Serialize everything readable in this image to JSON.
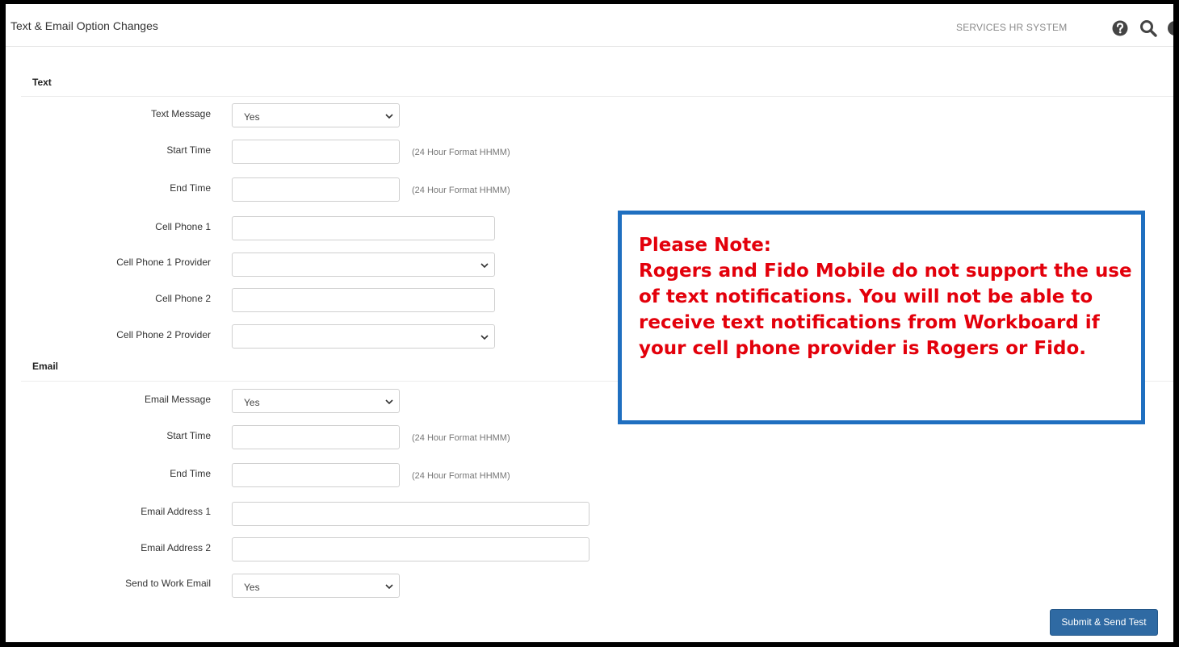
{
  "header": {
    "title": "Text & Email Option Changes",
    "system_name": "SERVICES HR SYSTEM",
    "icons": [
      "help-icon",
      "search-icon"
    ]
  },
  "text_section": {
    "title": "Text",
    "text_message": {
      "label": "Text Message",
      "value": "Yes"
    },
    "start_time": {
      "label": "Start Time",
      "value": "",
      "hint": "(24 Hour Format HHMM)"
    },
    "end_time": {
      "label": "End Time",
      "value": "",
      "hint": "(24 Hour Format HHMM)"
    },
    "cell_phone_1": {
      "label": "Cell Phone 1",
      "value": ""
    },
    "cell_phone_1_provider": {
      "label": "Cell Phone 1 Provider",
      "value": ""
    },
    "cell_phone_2": {
      "label": "Cell Phone 2",
      "value": ""
    },
    "cell_phone_2_provider": {
      "label": "Cell Phone 2 Provider",
      "value": ""
    }
  },
  "email_section": {
    "title": "Email",
    "email_message": {
      "label": "Email Message",
      "value": "Yes"
    },
    "start_time": {
      "label": "Start Time",
      "value": "",
      "hint": "(24 Hour Format HHMM)"
    },
    "end_time": {
      "label": "End Time",
      "value": "",
      "hint": "(24 Hour Format HHMM)"
    },
    "email_address_1": {
      "label": "Email Address 1",
      "value": ""
    },
    "email_address_2": {
      "label": "Email Address 2",
      "value": ""
    },
    "send_to_work_email": {
      "label": "Send to Work Email",
      "value": "Yes"
    }
  },
  "note": {
    "heading": "Please Note:",
    "body": "Rogers and Fido Mobile do not support the use of text notifications.  You will not be able to receive text notifications from Workboard if your cell phone provider is Rogers or Fido."
  },
  "actions": {
    "submit_label": "Submit & Send Test"
  },
  "colors": {
    "note_text": "#e3000b",
    "note_border": "#1f6fc0",
    "button": "#2f6aa3"
  }
}
